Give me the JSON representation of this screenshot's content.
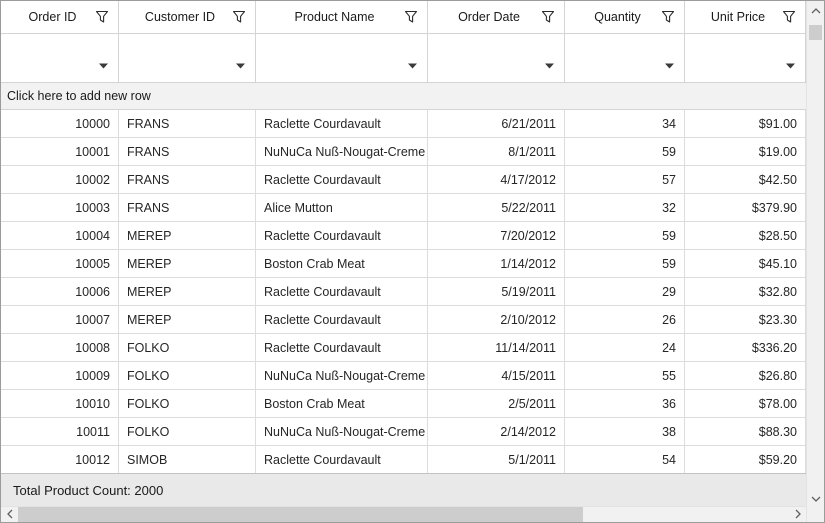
{
  "grid": {
    "columns": [
      {
        "label": "Order ID",
        "align": "right",
        "header_icon": "filter-funnel-icon"
      },
      {
        "label": "Customer ID",
        "align": "left",
        "header_icon": "filter-funnel-icon"
      },
      {
        "label": "Product Name",
        "align": "left",
        "header_icon": "filter-funnel-icon"
      },
      {
        "label": "Order Date",
        "align": "right",
        "header_icon": "filter-funnel-icon"
      },
      {
        "label": "Quantity",
        "align": "right",
        "header_icon": "filter-funnel-icon"
      },
      {
        "label": "Unit Price",
        "align": "right",
        "header_icon": "filter-funnel-icon"
      }
    ],
    "filter_row": {
      "dropdown_icon": "chevron-down-icon",
      "cell_value": ""
    },
    "add_new_row_label": "Click here to add new row",
    "rows": [
      [
        "10000",
        "FRANS",
        "Raclette Courdavault",
        "6/21/2011",
        "34",
        "$91.00"
      ],
      [
        "10001",
        "FRANS",
        "NuNuCa Nuß-Nougat-Creme",
        "8/1/2011",
        "59",
        "$19.00"
      ],
      [
        "10002",
        "FRANS",
        "Raclette Courdavault",
        "4/17/2012",
        "57",
        "$42.50"
      ],
      [
        "10003",
        "FRANS",
        "Alice Mutton",
        "5/22/2011",
        "32",
        "$379.90"
      ],
      [
        "10004",
        "MEREP",
        "Raclette Courdavault",
        "7/20/2012",
        "59",
        "$28.50"
      ],
      [
        "10005",
        "MEREP",
        "Boston Crab Meat",
        "1/14/2012",
        "59",
        "$45.10"
      ],
      [
        "10006",
        "MEREP",
        "Raclette Courdavault",
        "5/19/2011",
        "29",
        "$32.80"
      ],
      [
        "10007",
        "MEREP",
        "Raclette Courdavault",
        "2/10/2012",
        "26",
        "$23.30"
      ],
      [
        "10008",
        "FOLKO",
        "Raclette Courdavault",
        "11/14/2011",
        "24",
        "$336.20"
      ],
      [
        "10009",
        "FOLKO",
        "NuNuCa Nuß-Nougat-Creme",
        "4/15/2011",
        "55",
        "$26.80"
      ],
      [
        "10010",
        "FOLKO",
        "Boston Crab Meat",
        "2/5/2011",
        "36",
        "$78.00"
      ],
      [
        "10011",
        "FOLKO",
        "NuNuCa Nuß-Nougat-Creme",
        "2/14/2012",
        "38",
        "$88.30"
      ],
      [
        "10012",
        "SIMOB",
        "Raclette Courdavault",
        "5/1/2011",
        "54",
        "$59.20"
      ]
    ],
    "summary": {
      "label": "Total Product Count: 2000"
    }
  },
  "icons": {
    "header_filter": "filter-funnel-icon",
    "filter_dropdown": "chevron-down-icon",
    "scroll_up": "chevron-up-icon",
    "scroll_down": "chevron-down-icon",
    "scroll_left": "chevron-left-icon",
    "scroll_right": "chevron-right-icon"
  },
  "colors": {
    "header_text": "#1a1a1a",
    "cell_text": "#262626",
    "cell_border": "#dcdcdc",
    "header_border": "#d4d4d4",
    "outer_border": "#9b9b9b",
    "add_row_bg": "#f2f2f2",
    "summary_bg": "#e9e9e9",
    "scrollbar_track": "#f1f1f1",
    "scrollbar_thumb": "#cdcdcd",
    "icon_stroke": "#2b2b2b"
  }
}
